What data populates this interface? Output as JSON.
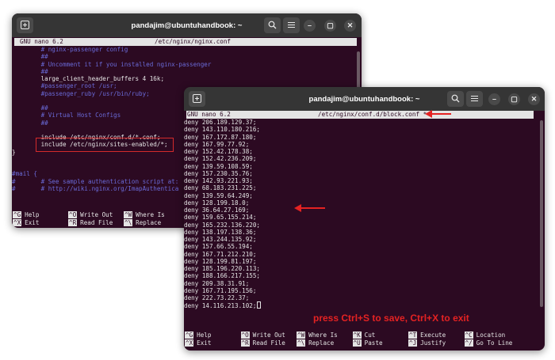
{
  "accent": "#e52222",
  "terminal_bg": "#2c0a22",
  "comment_color": "#6a6ad8",
  "win1": {
    "title": "pandajim@ubuntuhandbook: ~",
    "nano_version": "GNU nano 6.2",
    "file": "/etc/nginx/nginx.conf",
    "lines": [
      {
        "text": "        # nginx-passenger config",
        "kind": "cmt"
      },
      {
        "text": "        ##",
        "kind": "cmt"
      },
      {
        "text": "        # Uncomment it if you installed nginx-passenger",
        "kind": "cmt"
      },
      {
        "text": "        ##",
        "kind": "cmt"
      },
      {
        "text": "        large_client_header_buffers 4 16k;",
        "kind": "txt"
      },
      {
        "text": "        #passenger_root /usr;",
        "kind": "cmt"
      },
      {
        "text": "        #passenger_ruby /usr/bin/ruby;",
        "kind": "cmt"
      },
      {
        "text": "",
        "kind": "txt"
      },
      {
        "text": "        ##",
        "kind": "cmt"
      },
      {
        "text": "        # Virtual Host Configs",
        "kind": "cmt"
      },
      {
        "text": "        ##",
        "kind": "cmt"
      },
      {
        "text": "",
        "kind": "txt"
      },
      {
        "text": "        include /etc/nginx/conf.d/*.conf;",
        "kind": "txt"
      },
      {
        "text": "        include /etc/nginx/sites-enabled/*;",
        "kind": "txt"
      },
      {
        "text": "}",
        "kind": "txt"
      },
      {
        "text": "",
        "kind": "txt"
      },
      {
        "text": "",
        "kind": "txt"
      },
      {
        "text": "#mail {",
        "kind": "cmt"
      },
      {
        "text": "#       # See sample authentication script at:",
        "kind": "cmt"
      },
      {
        "text": "#       # http://wiki.nginx.org/ImapAuthentica",
        "kind": "cmt"
      }
    ],
    "help": [
      [
        {
          "key": "^G",
          "label": "Help"
        },
        {
          "key": "^O",
          "label": "Write Out"
        },
        {
          "key": "^W",
          "label": "Where Is"
        }
      ],
      [
        {
          "key": "^X",
          "label": "Exit"
        },
        {
          "key": "^R",
          "label": "Read File"
        },
        {
          "key": "^\\",
          "label": "Replace"
        }
      ]
    ]
  },
  "win2": {
    "title": "pandajim@ubuntuhandbook: ~",
    "nano_version": "GNU nano 6.2",
    "file": "/etc/nginx/conf.d/block.conf *",
    "lines": [
      "deny 206.189.129.37;",
      "deny 143.110.180.216;",
      "deny 167.172.87.180;",
      "deny 167.99.77.92;",
      "deny 152.42.178.38;",
      "deny 152.42.236.209;",
      "deny 139.59.108.59;",
      "deny 157.230.35.76;",
      "deny 142.93.221.93;",
      "deny 68.183.231.225;",
      "deny 139.59.64.249;",
      "deny 128.199.18.0;",
      "deny 36.64.27.169;",
      "deny 159.65.155.214;",
      "deny 165.232.136.220;",
      "deny 138.197.138.36;",
      "deny 143.244.135.92;",
      "deny 157.66.55.194;",
      "deny 167.71.212.210;",
      "deny 128.199.81.197;",
      "deny 185.196.220.113;",
      "deny 188.166.217.155;",
      "deny 209.38.31.91;",
      "deny 167.71.195.156;",
      "deny 222.73.22.37;",
      "deny 14.116.213.102;"
    ],
    "help": [
      [
        {
          "key": "^G",
          "label": "Help"
        },
        {
          "key": "^O",
          "label": "Write Out"
        },
        {
          "key": "^W",
          "label": "Where Is"
        },
        {
          "key": "^K",
          "label": "Cut"
        },
        {
          "key": "^T",
          "label": "Execute"
        },
        {
          "key": "^C",
          "label": "Location"
        }
      ],
      [
        {
          "key": "^X",
          "label": "Exit"
        },
        {
          "key": "^R",
          "label": "Read File"
        },
        {
          "key": "^\\",
          "label": "Replace"
        },
        {
          "key": "^U",
          "label": "Paste"
        },
        {
          "key": "^J",
          "label": "Justify"
        },
        {
          "key": "^/",
          "label": "Go To Line"
        }
      ]
    ]
  },
  "annotation": "press Ctrl+S to save, Ctrl+X to exit"
}
